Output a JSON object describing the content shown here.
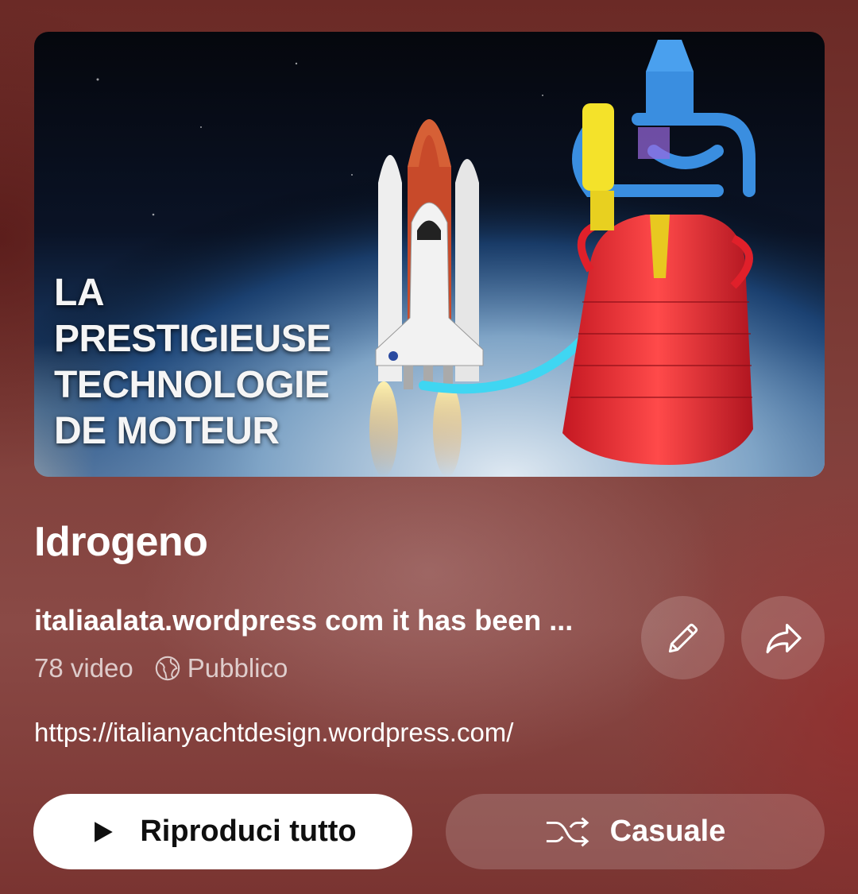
{
  "thumbnail": {
    "text_lines": [
      "LA",
      "PRESTIGIEUSE",
      "TECHNOLOGIE",
      "DE MOTEUR"
    ]
  },
  "playlist": {
    "title": "Idrogeno",
    "description": "italiaalata.wordpress com it has been ...",
    "video_count": "78 video",
    "visibility": "Pubblico",
    "url": "https://italianyachtdesign.wordpress.com/"
  },
  "actions": {
    "edit_icon": "pencil-icon",
    "share_icon": "share-arrow-icon",
    "play_all_label": "Riproduci tutto",
    "shuffle_label": "Casuale"
  }
}
